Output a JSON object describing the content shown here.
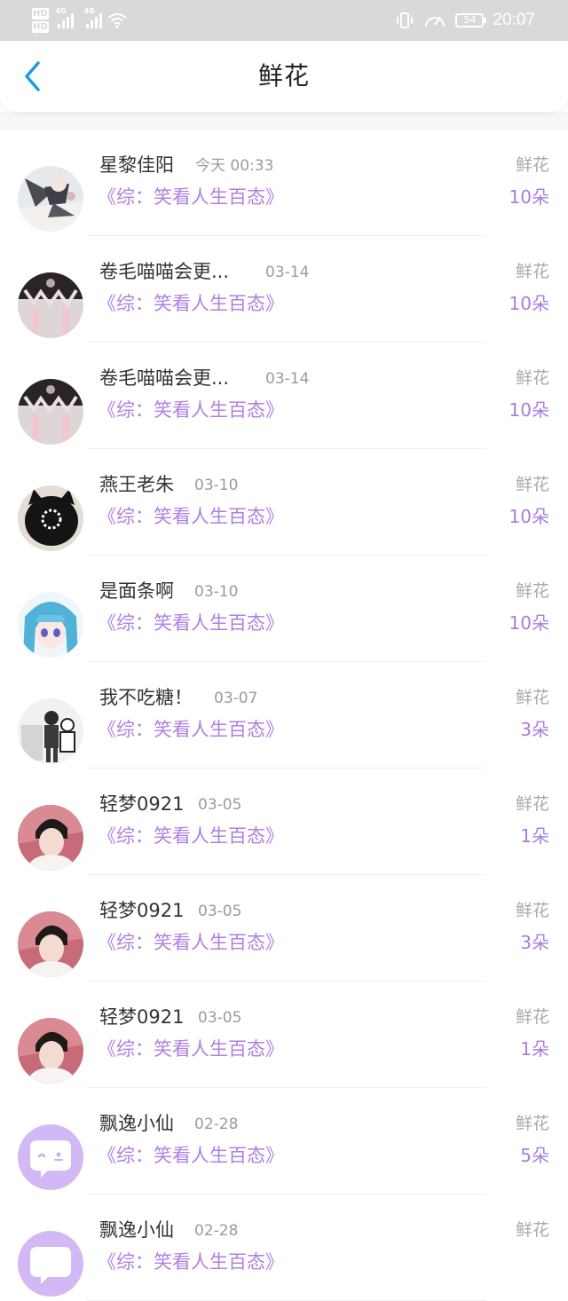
{
  "status_bar": {
    "hd1": "HD",
    "hd2": "HD",
    "net1": "4G",
    "net2": "4G",
    "battery": "54",
    "time": "20:07"
  },
  "header": {
    "title": "鲜花",
    "back_icon": "chevron-left-icon"
  },
  "colors": {
    "accent_back": "#1e9be0",
    "book_purple": "#b07fe0",
    "count_purple": "#a87ede"
  },
  "records": [
    {
      "name": "星黎佳阳",
      "time": "今天 00:33",
      "book": "《综：笑看人生百态》",
      "type": "鲜花",
      "count": "10朵"
    },
    {
      "name": "卷毛喵喵会更...",
      "time": "03-14",
      "book": "《综：笑看人生百态》",
      "type": "鲜花",
      "count": "10朵"
    },
    {
      "name": "卷毛喵喵会更...",
      "time": "03-14",
      "book": "《综：笑看人生百态》",
      "type": "鲜花",
      "count": "10朵"
    },
    {
      "name": "燕王老朱",
      "time": "03-10",
      "book": "《综：笑看人生百态》",
      "type": "鲜花",
      "count": "10朵"
    },
    {
      "name": "是面条啊",
      "time": "03-10",
      "book": "《综：笑看人生百态》",
      "type": "鲜花",
      "count": "10朵"
    },
    {
      "name": "我不吃糖！",
      "time": "03-07",
      "book": "《综：笑看人生百态》",
      "type": "鲜花",
      "count": "3朵"
    },
    {
      "name": "轻梦0921",
      "time": "03-05",
      "book": "《综：笑看人生百态》",
      "type": "鲜花",
      "count": "1朵"
    },
    {
      "name": "轻梦0921",
      "time": "03-05",
      "book": "《综：笑看人生百态》",
      "type": "鲜花",
      "count": "3朵"
    },
    {
      "name": "轻梦0921",
      "time": "03-05",
      "book": "《综：笑看人生百态》",
      "type": "鲜花",
      "count": "1朵"
    },
    {
      "name": "飘逸小仙",
      "time": "02-28",
      "book": "《综：笑看人生百态》",
      "type": "鲜花",
      "count": "5朵"
    },
    {
      "name": "飘逸小仙",
      "time": "02-28",
      "book": "《综：笑看人生百态》",
      "type": "鲜花",
      "count": ""
    }
  ]
}
